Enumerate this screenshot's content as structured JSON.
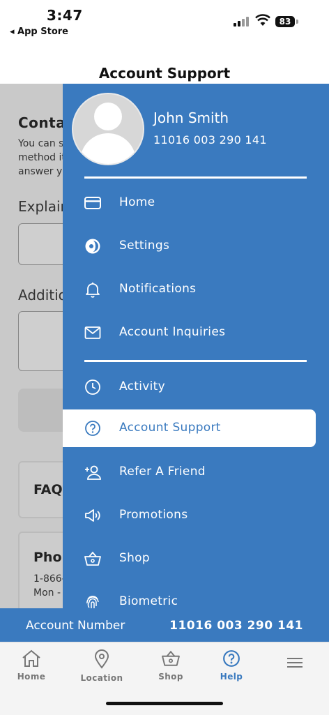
{
  "status": {
    "time": "3:47",
    "back_app": "◂ App Store",
    "battery": "83"
  },
  "header": {
    "title": "Account Support"
  },
  "background_page": {
    "heading": "Conta",
    "para_lines": [
      "You can s",
      "method it",
      "answer yo"
    ],
    "explain_label": "Explain",
    "additional_label": "Additio",
    "faq_title": "FAQs",
    "phone_title": "Phon",
    "phone_lines": [
      "1-866-",
      "Mon -"
    ]
  },
  "drawer": {
    "user_name": "John Smith",
    "account_number": "11016 003 290 141",
    "menu": [
      {
        "label": "Home",
        "icon": "card-icon"
      },
      {
        "label": "Settings",
        "icon": "settings-icon"
      },
      {
        "label": "Notifications",
        "icon": "bell-icon"
      },
      {
        "label": "Account Inquiries",
        "icon": "envelope-icon"
      },
      {
        "label": "Activity",
        "icon": "clock-icon"
      },
      {
        "label": "Account Support",
        "icon": "help-circle-icon",
        "active": true
      },
      {
        "label": "Refer A Friend",
        "icon": "add-person-icon"
      },
      {
        "label": "Promotions",
        "icon": "megaphone-icon"
      },
      {
        "label": "Shop",
        "icon": "basket-icon"
      },
      {
        "label": "Biometric",
        "icon": "fingerprint-icon"
      }
    ]
  },
  "account_bar": {
    "label": "Account Number",
    "value": "11016 003 290 141"
  },
  "tabs": [
    {
      "label": "Home",
      "icon": "house-icon"
    },
    {
      "label": "Location",
      "icon": "location-pin-icon"
    },
    {
      "label": "Shop",
      "icon": "basket-icon"
    },
    {
      "label": "Help",
      "icon": "help-circle-icon",
      "active": true
    },
    {
      "label": "",
      "icon": "hamburger-menu-icon"
    }
  ],
  "colors": {
    "brand_blue": "#3a7abf",
    "overlay_gray": "#c9c9c9"
  }
}
